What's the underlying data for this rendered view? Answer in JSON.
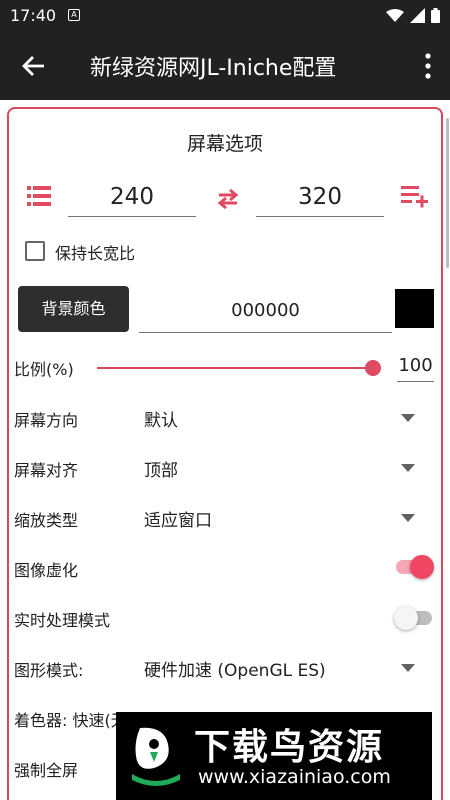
{
  "status_bar": {
    "time": "17:40",
    "notification": "A"
  },
  "app_bar": {
    "title": "新绿资源网JL-Iniche配置"
  },
  "screen_section": {
    "title": "屏幕选项",
    "width": "240",
    "height": "320",
    "keep_aspect_label": "保持长宽比",
    "keep_aspect_checked": false,
    "bg_color_button": "背景颜色",
    "bg_color_value": "000000",
    "bg_color_swatch": "#000000",
    "scale_label": "比例(%)",
    "scale_value": "100",
    "scale_fraction": 1.0
  },
  "settings": [
    {
      "label": "屏幕方向",
      "value": "默认"
    },
    {
      "label": "屏幕对齐",
      "value": "顶部"
    },
    {
      "label": "缩放类型",
      "value": "适应窗口"
    },
    {
      "label": "图像虚化",
      "switch_on": true
    },
    {
      "label": "实时处理模式",
      "switch_on": false
    },
    {
      "label": "图形模式:",
      "value": "硬件加速 (OpenGL ES)"
    },
    {
      "label": "着色器: 快速(无过滤)"
    },
    {
      "label": "强制全屏"
    }
  ],
  "watermark": {
    "title": "下载鸟资源",
    "url": "www.xiazainiao.com"
  },
  "colors": {
    "accent": "#e04a63",
    "appbar": "#212121",
    "button": "#2e2e2e"
  }
}
